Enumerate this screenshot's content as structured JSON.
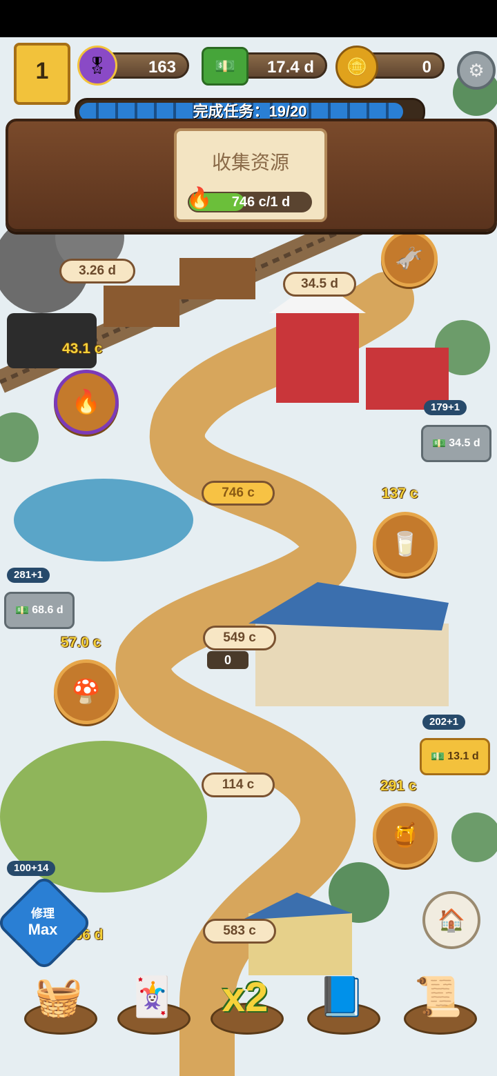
{
  "hud": {
    "level": "1",
    "resources": [
      {
        "name": "ribbon-icon",
        "value": "163"
      },
      {
        "name": "cash-icon",
        "value": "17.4 d"
      },
      {
        "name": "coin-icon",
        "value": "0"
      }
    ],
    "task_progress_label": "完成任务：",
    "task_progress_value": "19/20",
    "task_progress_fraction": 0.95
  },
  "task_card": {
    "title": "收集资源",
    "progress_value": "746 c/1 d"
  },
  "map_labels": {
    "train": "3.26 d",
    "barn": "34.5 d",
    "fire_production": "43.1 c",
    "pond_storage": "746 c",
    "milk_production": "137 c",
    "dairy_storage": "549 c",
    "cart_counter": "0",
    "mushroom_production": "57.0 c",
    "pig_storage": "114 c",
    "honey_production": "291 c",
    "bee_storage": "583 c",
    "bottom_left_value": "2.56 d"
  },
  "workers": {
    "barn": {
      "capacity": "179+1",
      "cash": "34.5 d"
    },
    "pond": {
      "capacity": "281+1",
      "cash": "68.6 d"
    },
    "dairy": {
      "capacity": "202+1",
      "cash": "13.1 d"
    },
    "pig": {
      "capacity": "100+14"
    }
  },
  "repair_badge": {
    "line1": "修理",
    "line2": "Max"
  },
  "bottom_bar": {
    "boost_label": "x2"
  },
  "colors": {
    "wood": "#6b4127",
    "progress_blue": "#2a7fd4",
    "snow": "#e9f1f4",
    "path": "#d7a65c"
  }
}
